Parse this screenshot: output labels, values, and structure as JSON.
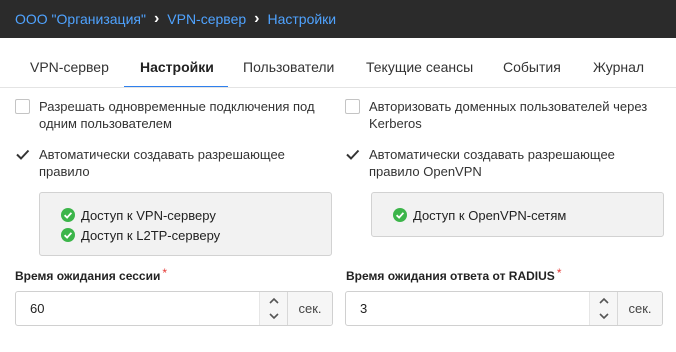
{
  "breadcrumb": {
    "org": "ООО \"Организация\"",
    "vpn": "VPN-сервер",
    "settings": "Настройки",
    "separator": "›"
  },
  "tabs": [
    {
      "label": "VPN-сервер",
      "active": false
    },
    {
      "label": "Настройки",
      "active": true
    },
    {
      "label": "Пользователи",
      "active": false
    },
    {
      "label": "Текущие сеансы",
      "active": false
    },
    {
      "label": "События",
      "active": false
    },
    {
      "label": "Журнал",
      "active": false
    }
  ],
  "options": {
    "simultaneous": {
      "label": "Разрешать одновременные подключения под\nодним пользователем",
      "checked": false
    },
    "kerberos": {
      "label": "Авторизовать доменных пользователей через\nKerberos",
      "checked": false
    },
    "auto_rule": {
      "label": "Автоматически создавать разрешающее\nправило",
      "checked": true
    },
    "auto_rule_openvpn": {
      "label": "Автоматически создавать разрешающее\nправило OpenVPN",
      "checked": true
    }
  },
  "rule_access": {
    "items": [
      "Доступ к VPN-серверу",
      "Доступ к L2TP-серверу"
    ]
  },
  "openvpn_access": {
    "items": [
      "Доступ к OpenVPN-сетям"
    ]
  },
  "session_timeout": {
    "label": "Время ожидания сессии",
    "required_mark": "*",
    "value": "60",
    "unit": "сек."
  },
  "radius_timeout": {
    "label": "Время ожидания ответа от RADIUS",
    "required_mark": "*",
    "value": "3",
    "unit": "сек."
  },
  "icons": {
    "check": "check-circle-icon",
    "checkbox_checked": "checkmark-icon",
    "stepper_up": "chevron-up-icon",
    "stepper_down": "chevron-down-icon"
  },
  "colors": {
    "topbar_bg": "#2b2b2b",
    "link": "#4fa3ff",
    "active_tab_underline": "#2f80ed",
    "success": "#3cb54a",
    "required": "#e53935"
  }
}
